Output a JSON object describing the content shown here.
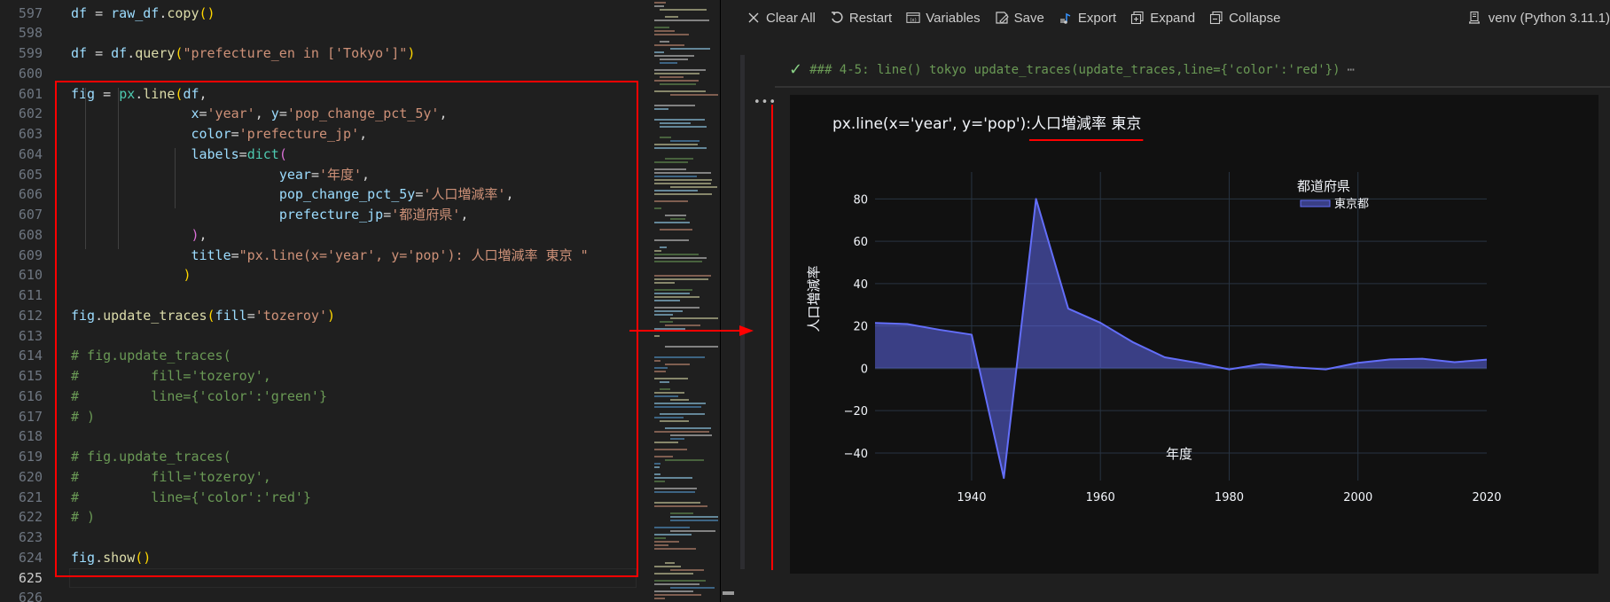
{
  "editor": {
    "first_line": 597,
    "active_line": 625,
    "lines": [
      {
        "n": 597,
        "tokens": [
          [
            "t-var",
            "df"
          ],
          [
            "t-op",
            " = "
          ],
          [
            "t-var",
            "raw_df"
          ],
          [
            "t-op",
            "."
          ],
          [
            "t-fn",
            "copy"
          ],
          [
            "t-p1",
            "()"
          ]
        ]
      },
      {
        "n": 598,
        "tokens": []
      },
      {
        "n": 599,
        "tokens": [
          [
            "t-var",
            "df"
          ],
          [
            "t-op",
            " = "
          ],
          [
            "t-var",
            "df"
          ],
          [
            "t-op",
            "."
          ],
          [
            "t-fn",
            "query"
          ],
          [
            "t-p1",
            "("
          ],
          [
            "t-str",
            "\"prefecture_en in ['Tokyo']\""
          ],
          [
            "t-p1",
            ")"
          ]
        ]
      },
      {
        "n": 600,
        "tokens": []
      },
      {
        "n": 601,
        "tokens": [
          [
            "t-var",
            "fig"
          ],
          [
            "t-op",
            " = "
          ],
          [
            "t-mod",
            "px"
          ],
          [
            "t-op",
            "."
          ],
          [
            "t-fn",
            "line"
          ],
          [
            "t-p1",
            "("
          ],
          [
            "t-var",
            "df"
          ],
          [
            "t-op",
            ","
          ]
        ]
      },
      {
        "n": 602,
        "tokens": [
          [
            "t-op",
            "               "
          ],
          [
            "t-var",
            "x"
          ],
          [
            "t-op",
            "="
          ],
          [
            "t-str",
            "'year'"
          ],
          [
            "t-op",
            ", "
          ],
          [
            "t-var",
            "y"
          ],
          [
            "t-op",
            "="
          ],
          [
            "t-str",
            "'pop_change_pct_5y'"
          ],
          [
            "t-op",
            ","
          ]
        ]
      },
      {
        "n": 603,
        "tokens": [
          [
            "t-op",
            "               "
          ],
          [
            "t-var",
            "color"
          ],
          [
            "t-op",
            "="
          ],
          [
            "t-str",
            "'prefecture_jp'"
          ],
          [
            "t-op",
            ","
          ]
        ]
      },
      {
        "n": 604,
        "tokens": [
          [
            "t-op",
            "               "
          ],
          [
            "t-var",
            "labels"
          ],
          [
            "t-op",
            "="
          ],
          [
            "t-mod",
            "dict"
          ],
          [
            "t-p2",
            "("
          ]
        ]
      },
      {
        "n": 605,
        "tokens": [
          [
            "t-op",
            "                          "
          ],
          [
            "t-var",
            "year"
          ],
          [
            "t-op",
            "="
          ],
          [
            "t-str",
            "'年度'"
          ],
          [
            "t-op",
            ","
          ]
        ]
      },
      {
        "n": 606,
        "tokens": [
          [
            "t-op",
            "                          "
          ],
          [
            "t-var",
            "pop_change_pct_5y"
          ],
          [
            "t-op",
            "="
          ],
          [
            "t-str",
            "'人口増減率'"
          ],
          [
            "t-op",
            ","
          ]
        ]
      },
      {
        "n": 607,
        "tokens": [
          [
            "t-op",
            "                          "
          ],
          [
            "t-var",
            "prefecture_jp"
          ],
          [
            "t-op",
            "="
          ],
          [
            "t-str",
            "'都道府県'"
          ],
          [
            "t-op",
            ","
          ]
        ]
      },
      {
        "n": 608,
        "tokens": [
          [
            "t-op",
            "               "
          ],
          [
            "t-p2",
            ")"
          ],
          [
            "t-op",
            ","
          ]
        ]
      },
      {
        "n": 609,
        "tokens": [
          [
            "t-op",
            "               "
          ],
          [
            "t-var",
            "title"
          ],
          [
            "t-op",
            "="
          ],
          [
            "t-str",
            "\"px.line(x='year', y='pop'): 人口増減率 東京 \""
          ]
        ]
      },
      {
        "n": 610,
        "tokens": [
          [
            "t-op",
            "              "
          ],
          [
            "t-p1",
            ")"
          ]
        ]
      },
      {
        "n": 611,
        "tokens": []
      },
      {
        "n": 612,
        "tokens": [
          [
            "t-var",
            "fig"
          ],
          [
            "t-op",
            "."
          ],
          [
            "t-fn",
            "update_traces"
          ],
          [
            "t-p1",
            "("
          ],
          [
            "t-var",
            "fill"
          ],
          [
            "t-op",
            "="
          ],
          [
            "t-str",
            "'tozeroy'"
          ],
          [
            "t-p1",
            ")"
          ]
        ]
      },
      {
        "n": 613,
        "tokens": []
      },
      {
        "n": 614,
        "tokens": [
          [
            "t-cmt",
            "# fig.update_traces("
          ]
        ]
      },
      {
        "n": 615,
        "tokens": [
          [
            "t-cmt",
            "#         fill='tozeroy',"
          ]
        ]
      },
      {
        "n": 616,
        "tokens": [
          [
            "t-cmt",
            "#         line={'color':'green'}"
          ]
        ]
      },
      {
        "n": 617,
        "tokens": [
          [
            "t-cmt",
            "# )"
          ]
        ]
      },
      {
        "n": 618,
        "tokens": []
      },
      {
        "n": 619,
        "tokens": [
          [
            "t-cmt",
            "# fig.update_traces("
          ]
        ]
      },
      {
        "n": 620,
        "tokens": [
          [
            "t-cmt",
            "#         fill='tozeroy',"
          ]
        ]
      },
      {
        "n": 621,
        "tokens": [
          [
            "t-cmt",
            "#         line={'color':'red'}"
          ]
        ]
      },
      {
        "n": 622,
        "tokens": [
          [
            "t-cmt",
            "# )"
          ]
        ]
      },
      {
        "n": 623,
        "tokens": []
      },
      {
        "n": 624,
        "tokens": [
          [
            "t-var",
            "fig"
          ],
          [
            "t-op",
            "."
          ],
          [
            "t-fn",
            "show"
          ],
          [
            "t-p1",
            "()"
          ]
        ]
      },
      {
        "n": 625,
        "tokens": []
      },
      {
        "n": 626,
        "tokens": []
      }
    ]
  },
  "toolbar": {
    "clear_all": "Clear All",
    "restart": "Restart",
    "variables": "Variables",
    "save": "Save",
    "export": "Export",
    "expand": "Expand",
    "collapse": "Collapse",
    "kernel": "venv (Python 3.11.1)"
  },
  "cell": {
    "status_text": "### 4-5: line() tokyo update_traces(update_traces,line={'color':'red'})",
    "ellipsis": "⋯",
    "output_more": "•••"
  },
  "colors": {
    "line": "#636efa",
    "fill": "rgba(99,110,250,0.5)",
    "highlight": "#ff0000",
    "plot_bg": "#111111",
    "grid": "#283442"
  },
  "chart_data": {
    "type": "area",
    "title_prefix": "px.line(x='year', y='pop'): ",
    "title_jp": "人口増減率 東京",
    "xlabel": "年度",
    "ylabel": "人口増減率",
    "legend_title": "都道府県",
    "legend_placement": "top-right",
    "x_ticks": [
      1940,
      1960,
      1980,
      2000,
      2020
    ],
    "y_ticks": [
      -40,
      -20,
      0,
      20,
      40,
      60,
      80
    ],
    "y_tick_labels": [
      "−40",
      "−20",
      "0",
      "20",
      "40",
      "60",
      "80"
    ],
    "xlim": [
      1925,
      2020
    ],
    "ylim": [
      -53,
      86
    ],
    "grid": true,
    "series": [
      {
        "name": "東京都",
        "x": [
          1925,
          1930,
          1935,
          1940,
          1945,
          1950,
          1955,
          1960,
          1965,
          1970,
          1975,
          1980,
          1985,
          1990,
          1995,
          2000,
          2005,
          2010,
          2015,
          2020
        ],
        "y": [
          21.4,
          20.9,
          18.2,
          15.9,
          -51.8,
          80.0,
          28.2,
          21.5,
          12.4,
          5.2,
          2.6,
          -0.5,
          2.0,
          0.5,
          -0.5,
          2.6,
          4.2,
          4.5,
          2.9,
          4.1
        ]
      }
    ]
  }
}
